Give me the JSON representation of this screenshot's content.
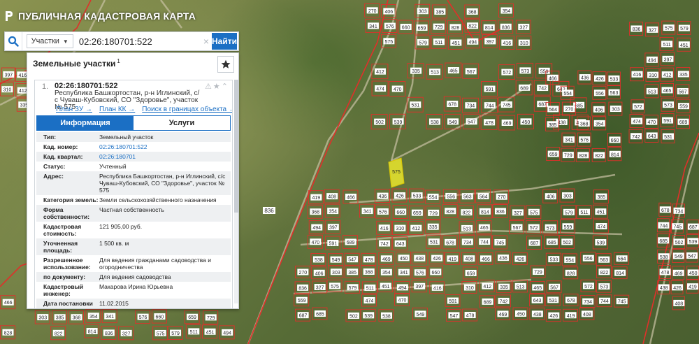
{
  "app": {
    "title": "ПУБЛИЧНАЯ КАДАСТРОВАЯ КАРТА"
  },
  "search": {
    "type_label": "Участки",
    "value": "02:26:180701:522",
    "button_label": "Найти"
  },
  "panel": {
    "title": "Земельные участки",
    "count": "1"
  },
  "result": {
    "index": "1.",
    "number": "02:26:180701:522",
    "address": "Республика Башкортостан, р-н Иглинский, с/с Чуваш-Кубовский, СО \"Здоровье\", участок № 575",
    "links": [
      "План ЗУ →",
      "План КК →",
      "Поиск в границах объекта →"
    ],
    "tabs": [
      "Информация",
      "Услуги"
    ],
    "properties": [
      {
        "label": "Тип:",
        "value": "Земельный участок"
      },
      {
        "label": "Кад. номер:",
        "value": "02:26:180701:522"
      },
      {
        "label": "Кад. квартал:",
        "value": "02:26:180701"
      },
      {
        "label": "Статус:",
        "value": "Учтенный"
      },
      {
        "label": "Адрес:",
        "value": "Республика Башкортостан, р-н Иглинский, с/с Чуваш-Кубовский, СО \"Здоровье\", участок № 575"
      },
      {
        "label": "Категория земель:",
        "value": "Земли сельскохозяйственного назначения"
      },
      {
        "label": "Форма собственности:",
        "value": "Частная собственность"
      },
      {
        "label": "Кадастровая стоимость:",
        "value": "121 905,00 руб."
      },
      {
        "label": "Уточненная площадь:",
        "value": "1 500 кв. м"
      },
      {
        "label": "Разрешенное использование:",
        "value": "Для ведения гражданами садоводства и огородничества"
      },
      {
        "label": "по документу:",
        "value": "Для ведения садоводства"
      },
      {
        "label": "Кадастровый инженер:",
        "value": "Макарова Ирина Юрьевна"
      },
      {
        "label": "Дата постановки на учет:",
        "value": "11.02.2015"
      }
    ]
  },
  "map": {
    "parcel_labels": [
      "270",
      "406",
      "303",
      "385",
      "368",
      "354",
      "341",
      "576",
      "660",
      "659",
      "729",
      "828",
      "822",
      "814",
      "836",
      "327",
      "575",
      "579",
      "511",
      "451",
      "494",
      "397",
      "416",
      "310",
      "412",
      "335",
      "513",
      "465",
      "567",
      "572",
      "573",
      "559",
      "474",
      "470",
      "591",
      "689",
      "742",
      "643",
      "531",
      "678",
      "734",
      "744",
      "745",
      "687",
      "685",
      "502",
      "539",
      "538",
      "549",
      "547",
      "478",
      "469",
      "450",
      "438",
      "426",
      "419",
      "408",
      "466",
      "436",
      "426",
      "533",
      "554",
      "556",
      "563",
      "564"
    ]
  },
  "colors": {
    "accent": "#1b6fc4",
    "parcel_border": "#e0302a",
    "selected_parcel": "#f3ee2c"
  }
}
